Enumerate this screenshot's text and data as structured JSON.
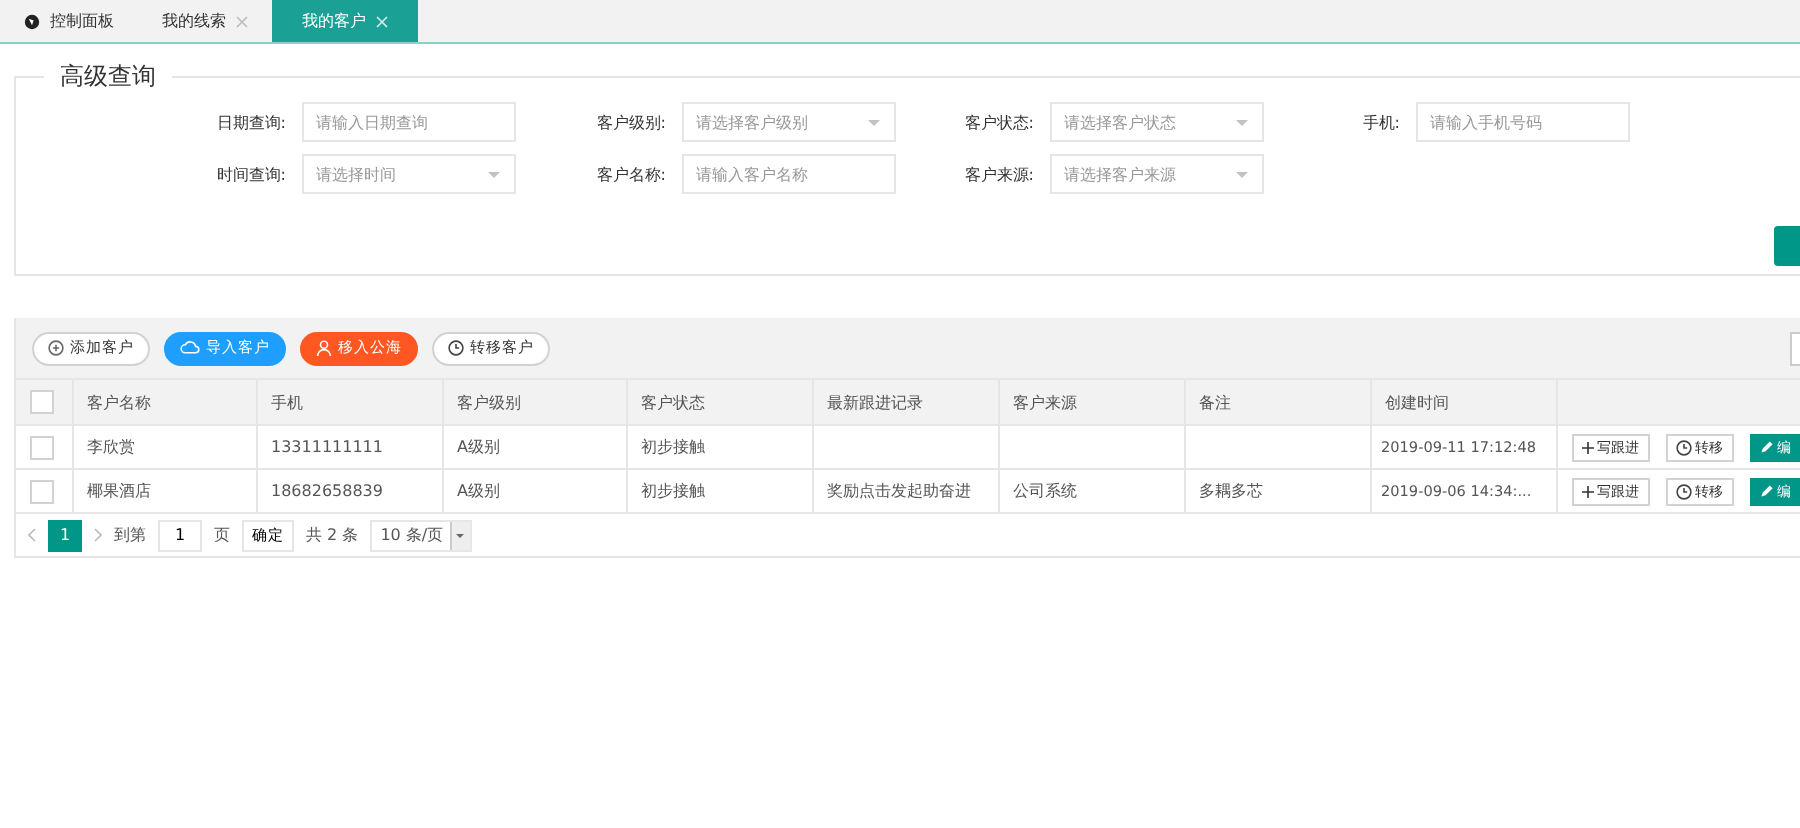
{
  "tabs": [
    {
      "label": "控制面板",
      "kind": "home",
      "selected": false
    },
    {
      "label": "我的线索",
      "kind": "closable",
      "selected": false
    },
    {
      "label": "我的客户",
      "kind": "closable",
      "selected": true
    }
  ],
  "query": {
    "legend": "高级查询",
    "fields": [
      {
        "label": "日期查询:",
        "kind": "input",
        "placeholder": "请输入日期查询"
      },
      {
        "label": "客户级别:",
        "kind": "select",
        "placeholder": "请选择客户级别"
      },
      {
        "label": "客户状态:",
        "kind": "select",
        "placeholder": "请选择客户状态"
      },
      {
        "label": "手机:",
        "kind": "input",
        "placeholder": "请输入手机号码"
      },
      {
        "label": "时间查询:",
        "kind": "select",
        "placeholder": "请选择时间"
      },
      {
        "label": "客户名称:",
        "kind": "input",
        "placeholder": "请输入客户名称"
      },
      {
        "label": "客户来源:",
        "kind": "select",
        "placeholder": "请选择客户来源"
      }
    ]
  },
  "toolbar": [
    {
      "label": "添加客户",
      "kind": "add"
    },
    {
      "label": "导入客户",
      "kind": "import"
    },
    {
      "label": "移入公海",
      "kind": "move"
    },
    {
      "label": "转移客户",
      "kind": "transfer"
    }
  ],
  "table": {
    "columns": [
      "客户名称",
      "手机",
      "客户级别",
      "客户状态",
      "最新跟进记录",
      "客户来源",
      "备注",
      "创建时间"
    ],
    "header_checked": false,
    "rows": [
      {
        "checked": false,
        "cells": [
          "李欣赏",
          "13311111111",
          "A级别",
          "初步接触",
          "",
          "",
          "",
          "2019-09-11 17:12:48"
        ],
        "actions": [
          "写跟进",
          "转移",
          "编"
        ]
      },
      {
        "checked": false,
        "cells": [
          "椰果酒店",
          "18682658839",
          "A级别",
          "初步接触",
          "奖励点击发起助奋进",
          "公司系统",
          "多耦多芯",
          "2019-09-06 14:34:..."
        ],
        "actions": [
          "写跟进",
          "转移",
          "编"
        ]
      }
    ]
  },
  "pagination": {
    "current": "1",
    "goto_label": "到第",
    "page_input": "1",
    "page_unit": "页",
    "confirm": "确定",
    "total": "共 2 条",
    "page_size": "10 条/页"
  }
}
